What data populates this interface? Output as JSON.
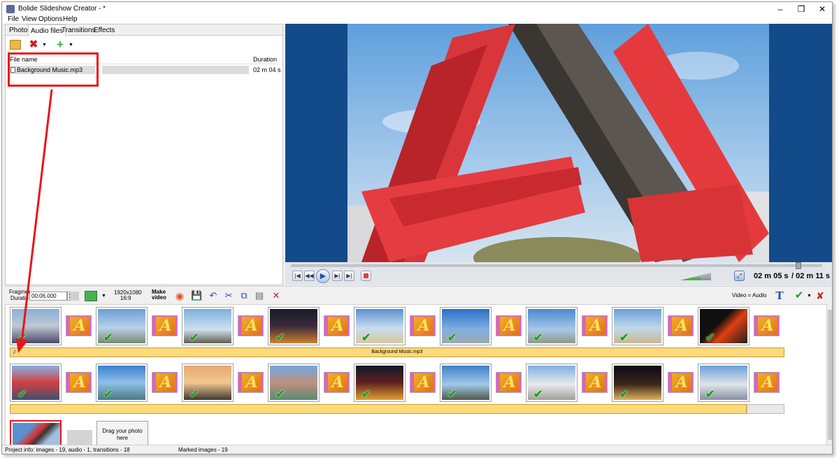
{
  "app": {
    "title": "Bolide Slideshow Creator - *"
  },
  "menu": [
    "File",
    "View",
    "Options",
    "Help"
  ],
  "tabs": [
    "Photos",
    "Audio files",
    "Transitions",
    "Effects"
  ],
  "audio_list": {
    "col_filename": "File name",
    "col_duration": "Duration",
    "rows": [
      {
        "name": "Background Music.mp3",
        "duration": "02 m 04 s"
      }
    ]
  },
  "player": {
    "current_time": "02 m 05 s",
    "total_time": "/ 02 m 11 s",
    "seek_fraction": 0.96,
    "volume_fraction": 0.65
  },
  "bottom_toolbar": {
    "fragment_label": "Fragmer",
    "duration_label": "Duratio",
    "duration_value": "00:06.000",
    "resolution": "1920x1080",
    "aspect": "16:9",
    "make_video_1": "Make",
    "make_video_2": "video",
    "video_audio_label": "Video = Audio"
  },
  "timeline": {
    "audio_track_label": "Background Music.mp3",
    "drag_hint": "Drag your photo here"
  },
  "status": {
    "project_info": "Project info: images - 19, audio - 1, transitions - 18",
    "marked": "Marked images - 19"
  },
  "colors": {
    "accent_red": "#e8141b",
    "stage_blue": "#124a8a",
    "audio_bar": "#fcd97a",
    "transition_pink": "#e060c0"
  }
}
